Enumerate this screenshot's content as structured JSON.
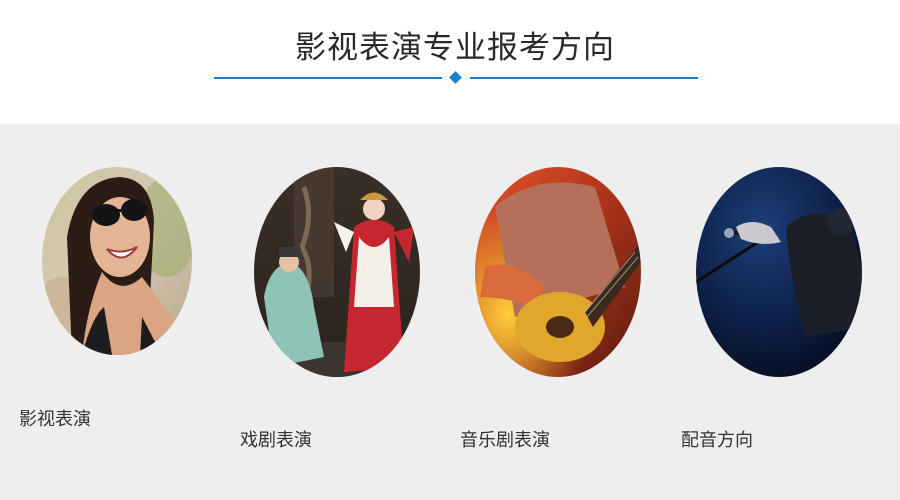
{
  "header": {
    "title": "影视表演专业报考方向",
    "accent_color": "#1d7fd1"
  },
  "directions": [
    {
      "label": "影视表演",
      "image": "smiling-woman-sunglasses-photo"
    },
    {
      "label": "戏剧表演",
      "image": "peking-opera-performers-photo"
    },
    {
      "label": "音乐剧表演",
      "image": "guitarist-stage-lights-photo"
    },
    {
      "label": "配音方向",
      "image": "hand-holding-microphone-photo"
    }
  ]
}
